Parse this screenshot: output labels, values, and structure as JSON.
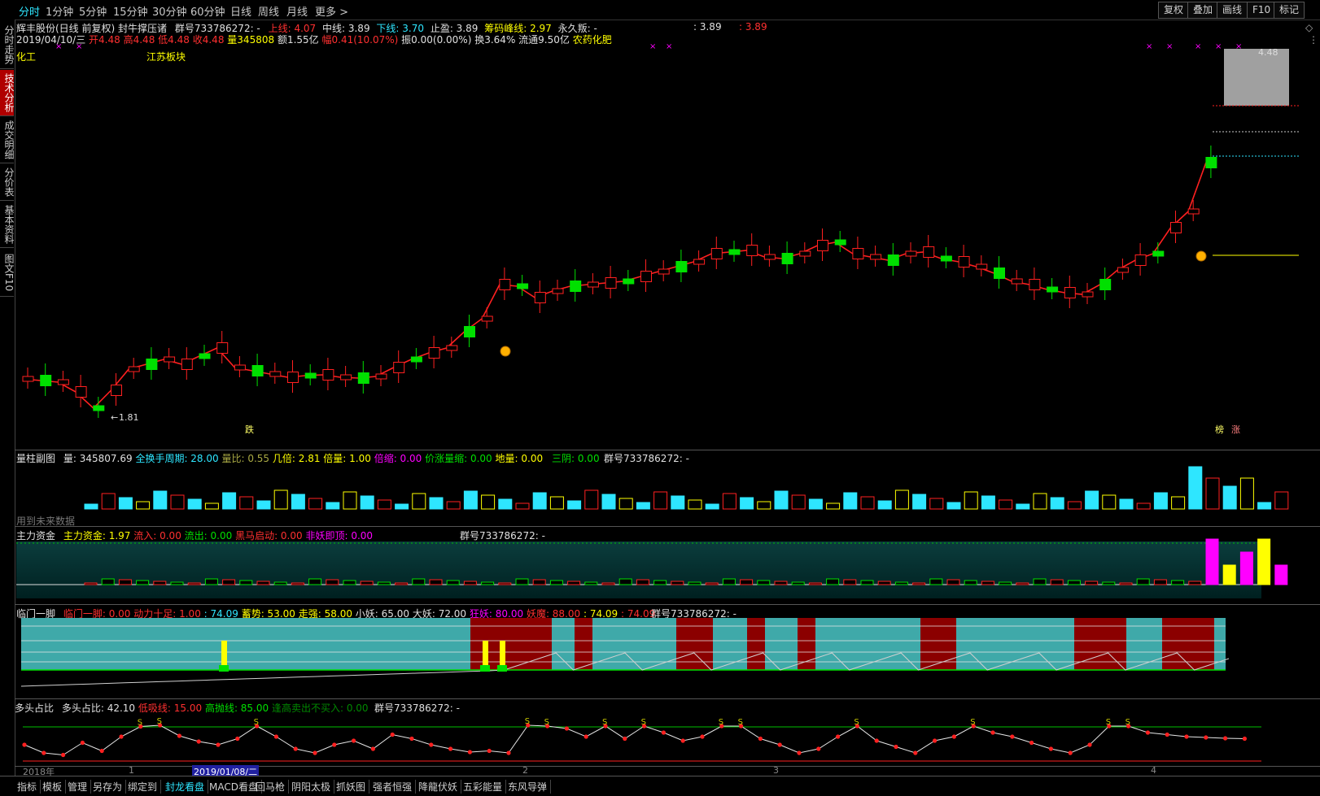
{
  "toolbar": {
    "timeframes": [
      "分时",
      "1分钟",
      "5分钟",
      "15分钟",
      "30分钟",
      "60分钟",
      "日线",
      "周线",
      "月线",
      "更多 >"
    ],
    "right_buttons": [
      "复权",
      "叠加",
      "画线",
      "F10",
      "标记"
    ],
    "diamond_icon": "◇",
    "more_icon": "⋮"
  },
  "left_tabs": [
    "分时走势",
    "技术分析",
    "成交明细",
    "分价表",
    "基本资料",
    "图文F10"
  ],
  "main_chart": {
    "stock_name": "辉丰股份(日线 前复权)",
    "indicator_name": "封牛撑压诸",
    "group_no": "群号733786272: -",
    "upper_label": "上线: 4.07",
    "mid_label": "中线: 3.89",
    "lower_label": "下线: 3.70",
    "stop_label": "止盈: 3.89",
    "chip_label": "筹码峰线: 2.97",
    "forever_label": "永久叛: -",
    "right_val1": ": 3.89",
    "right_val2": ": 3.89",
    "date": "2019/04/10/三",
    "open": "开4.48",
    "high": "高4.48",
    "low": "低4.48",
    "close": "收4.48",
    "volume": "量345808",
    "amount": "额1.55亿",
    "change": "幅0.41(10.07%)",
    "amplitude": "振0.00(0.00%)",
    "turnover": "换3.64%",
    "float_mv": "流通9.50亿",
    "sector_tag": "农药化肥",
    "industry": "化工",
    "region": "江苏板块",
    "high_mark": "4.48",
    "low_mark": "1.81",
    "bottom_tag_left": "跌",
    "bottom_tag_right1": "榜",
    "bottom_tag_right2": "涨"
  },
  "vol_panel": {
    "title": "量柱副图",
    "vol": "量: 345807.69",
    "full_turn": "全换手周期: 28.00",
    "vol_ratio": "量比: 0.55",
    "times": "几倍: 2.81",
    "double": "倍量: 1.00",
    "shrink": "倍缩: 0.00",
    "price_up_shrink": "价涨量缩: 0.00",
    "ground": "地量: 0.00",
    "three_yin": "三阴: 0.00",
    "group_no": "群号733786272: -",
    "future_note": "用到未来数据"
  },
  "fund_panel": {
    "title": "主力资金",
    "main": "主力资金: 1.97",
    "inflow": "流入: 0.00",
    "outflow": "流出: 0.00",
    "dark_horse": "黑马启动: 0.00",
    "demon": "非妖即顶: 0.00",
    "group_no": "群号733786272: -"
  },
  "kick_panel": {
    "title": "临门一脚",
    "kick": "临门一脚: 0.00",
    "power": "动力十足: 1.00",
    "v1": ": 74.09",
    "momentum": "蓄势: 53.00",
    "strong": "走强: 58.00",
    "small_demon": "小妖: 65.00",
    "big_demon": "大妖: 72.00",
    "crazy": "狂妖: 80.00",
    "demon_king": "妖魔: 88.00",
    "v2": ": 74.09",
    "v3": ": 74.09",
    "group_no": "群号733786272: -"
  },
  "bull_panel": {
    "title": "多头占比",
    "ratio": "多头占比: 42.10",
    "low_buy": "低吸线: 15.00",
    "high_sell": "高抛线: 85.00",
    "warn": "逢高卖出不买入: 0.00",
    "group_no": "群号733786272: -"
  },
  "xaxis": {
    "labels": [
      "2018年",
      "1",
      "2019/01/08/二",
      "2",
      "3",
      "4"
    ]
  },
  "bottom_tabs": [
    "指标",
    "模板",
    "管理",
    "另存为",
    "绑定到",
    "封龙看盘",
    "MACD看盘",
    "回马枪",
    "阴阳太极",
    "抓妖图",
    "强者恒强",
    "降龍伏妖",
    "五彩能量",
    "东风导弹"
  ],
  "colors": {
    "up": "#ff2020",
    "down": "#00e000",
    "cyan": "#2ee6ff",
    "magenta": "#ff00ff",
    "yellow": "#ffff00",
    "darkred": "#8b0000",
    "teal": "#3fa9a9"
  }
}
